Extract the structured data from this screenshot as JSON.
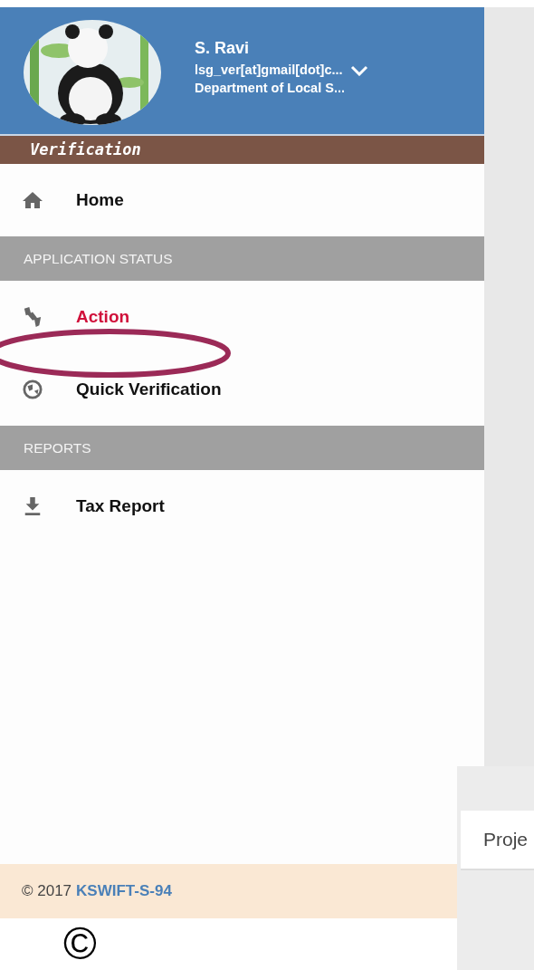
{
  "profile": {
    "name": "S. Ravi",
    "email": "lsg_ver[at]gmail[dot]c...",
    "department": "Department of Local S..."
  },
  "role_banner": "Verification",
  "menu": [
    {
      "kind": "item",
      "label": "Home",
      "selected": false
    },
    {
      "kind": "section",
      "label": "APPLICATION STATUS"
    },
    {
      "kind": "item",
      "label": "Action",
      "selected": true
    },
    {
      "kind": "item",
      "label": "Quick Verification",
      "selected": false
    },
    {
      "kind": "section",
      "label": "REPORTS"
    },
    {
      "kind": "item",
      "label": "Tax Report",
      "selected": false
    }
  ],
  "footer": {
    "copyright": "© 2017",
    "link": "KSWIFT-S-94"
  },
  "copyright_mark": "©",
  "content_card": {
    "text": "Proje"
  }
}
